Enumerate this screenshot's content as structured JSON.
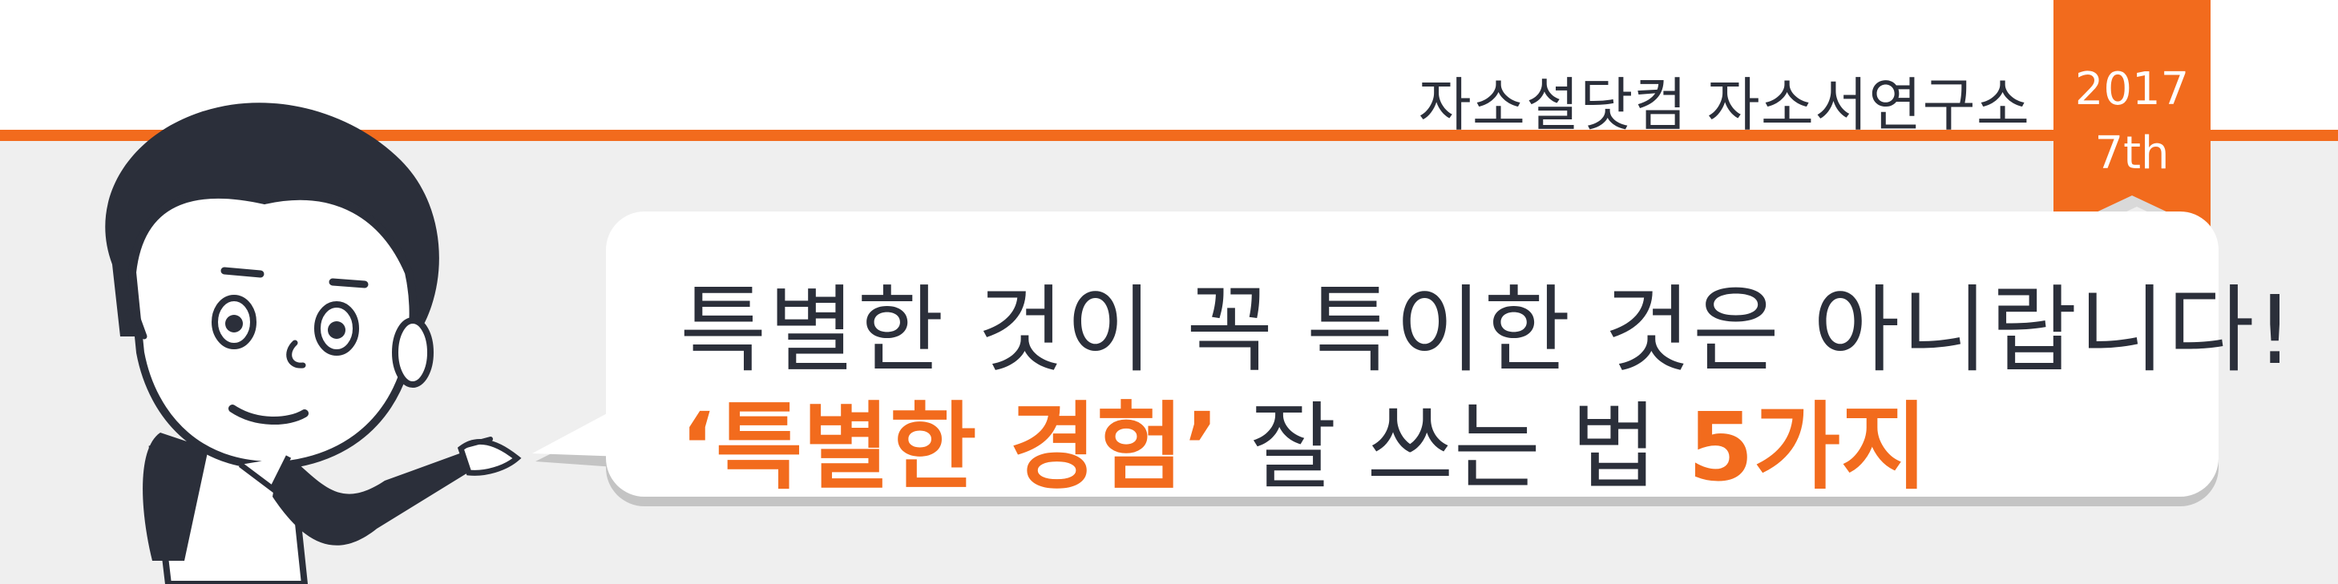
{
  "header": {
    "brand": "자소설닷컴 자소서연구소",
    "badge_year": "2017",
    "badge_issue": "7th"
  },
  "headline": {
    "line1": "특별한 것이 꼭 특이한 것은 아니랍니다!",
    "line2_quote": "‘특별한 경험’",
    "line2_middle": " 잘 쓰는 법 ",
    "line2_count": "5가지"
  },
  "colors": {
    "accent": "#f26b1d",
    "text": "#2b2f3a",
    "background": "#efefef",
    "character_ink": "#2b2f3a"
  },
  "icons": {
    "character": "presenting-cartoon-man",
    "badge": "orange-bookmark-ribbon"
  }
}
